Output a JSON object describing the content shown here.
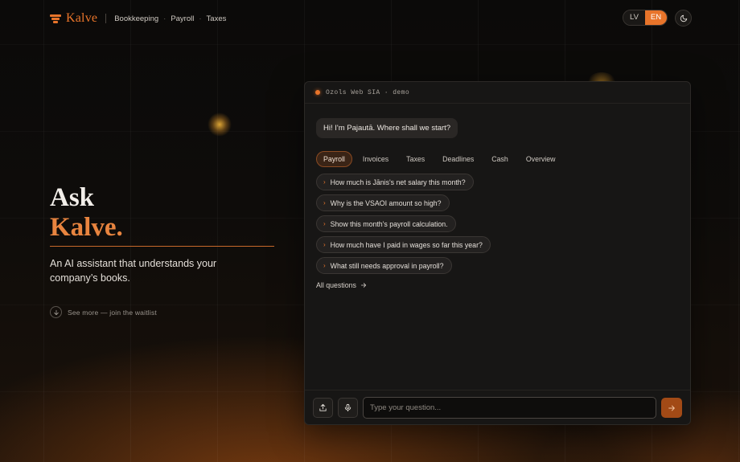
{
  "brand": {
    "name": "Kalve",
    "accent": "#e8742a"
  },
  "nav": {
    "items": [
      "Bookkeeping",
      "Payroll",
      "Taxes"
    ],
    "separator": "·"
  },
  "language": {
    "options": [
      "LV",
      "EN"
    ],
    "selected": "EN"
  },
  "theme_toggle": {
    "icon": "moon-icon"
  },
  "hero": {
    "title_line1": "Ask",
    "title_line2": "Kalve.",
    "subtitle": "An AI assistant that understands your company’s books.",
    "cta": "See more — join the waitlist"
  },
  "chat": {
    "header": "Ozols Web SIA · demo",
    "greeting": "Hi! I'm Pajautā. Where shall we start?",
    "tabs": [
      {
        "label": "Payroll",
        "active": true
      },
      {
        "label": "Invoices",
        "active": false
      },
      {
        "label": "Taxes",
        "active": false
      },
      {
        "label": "Deadlines",
        "active": false
      },
      {
        "label": "Cash",
        "active": false
      },
      {
        "label": "Overview",
        "active": false
      }
    ],
    "questions": [
      "How much is Jānis's net salary this month?",
      "Why is the VSAOI amount so high?",
      "Show this month's payroll calculation.",
      "How much have I paid in wages so far this year?",
      "What still needs approval in payroll?"
    ],
    "all_questions": "All questions",
    "input_placeholder": "Type your question...",
    "input_value": ""
  }
}
